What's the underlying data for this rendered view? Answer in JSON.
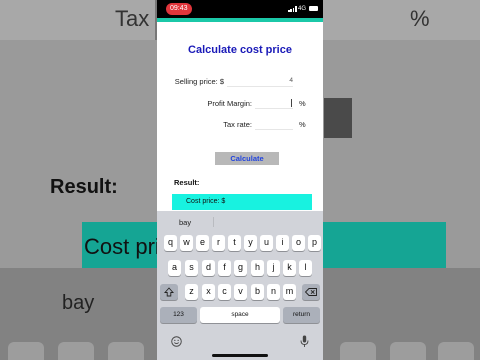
{
  "background": {
    "tax_text": "Tax r",
    "percent_text": "%",
    "result_text": "Result:",
    "cost_text": "Cost pric",
    "suggestion_text": "bay"
  },
  "status_bar": {
    "time": "09:43",
    "network": "4G"
  },
  "form": {
    "title": "Calculate cost price",
    "fields": [
      {
        "label": "Selling price: $",
        "value": "4",
        "unit": ""
      },
      {
        "label": "Profit Margin:",
        "value": "",
        "unit": "%"
      },
      {
        "label": "Tax rate:",
        "value": "",
        "unit": "%"
      }
    ],
    "calculate_label": "Calculate",
    "result_label": "Result:",
    "result_value": "Cost price: $"
  },
  "keyboard": {
    "suggestion": "bay",
    "row1": [
      "q",
      "w",
      "e",
      "r",
      "t",
      "y",
      "u",
      "i",
      "o",
      "p"
    ],
    "row2": [
      "a",
      "s",
      "d",
      "f",
      "g",
      "h",
      "j",
      "k",
      "l"
    ],
    "row3": [
      "z",
      "x",
      "c",
      "v",
      "b",
      "n",
      "m"
    ],
    "numbers_label": "123",
    "space_label": "space",
    "return_label": "return"
  },
  "colors": {
    "title": "#1a1ab8",
    "calculate_text": "#2244dd",
    "result_box": "#18f2e0",
    "time_pill": "#e0353b",
    "teal_strip": "#1bc8a8"
  }
}
